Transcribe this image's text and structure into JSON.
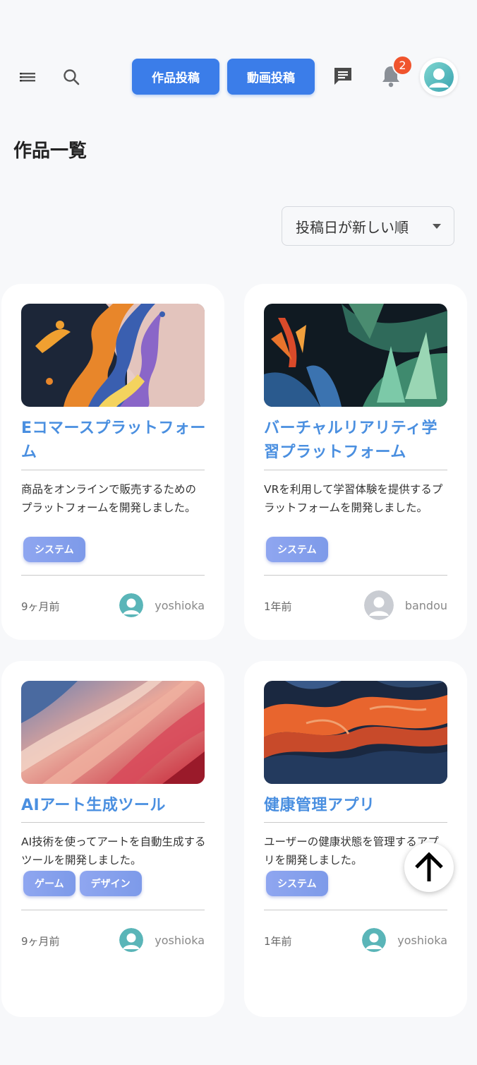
{
  "header": {
    "post_work_label": "作品投稿",
    "post_video_label": "動画投稿",
    "notification_count": "2",
    "accent_color": "#3b7de9"
  },
  "page": {
    "title": "作品一覧",
    "sort": {
      "selected": "投稿日が新しい順"
    }
  },
  "cards": [
    {
      "title": "Eコマースプラットフォーム",
      "description": "商品をオンラインで販売するためのプラットフォームを開発しました。",
      "tags": [
        "システム"
      ],
      "date": "9ヶ月前",
      "user": "yoshioka"
    },
    {
      "title": "バーチャルリアリティ学習プラットフォーム",
      "description": "VRを利用して学習体験を提供するプラットフォームを開発しました。",
      "tags": [
        "システム"
      ],
      "date": "1年前",
      "user": "bandou"
    },
    {
      "title": "AIアート生成ツール",
      "description": "AI技術を使ってアートを自動生成するツールを開発しました。",
      "tags": [
        "ゲーム",
        "デザイン"
      ],
      "date": "9ヶ月前",
      "user": "yoshioka"
    },
    {
      "title": "健康管理アプリ",
      "description": "ユーザーの健康状態を管理するアプリを開発しました。",
      "tags": [
        "システム"
      ],
      "date": "1年前",
      "user": "yoshioka"
    }
  ],
  "icons": {
    "menu": "menu-icon",
    "search": "search-icon",
    "chat": "chat-icon",
    "bell": "bell-icon",
    "scroll_top": "arrow-up-icon"
  }
}
